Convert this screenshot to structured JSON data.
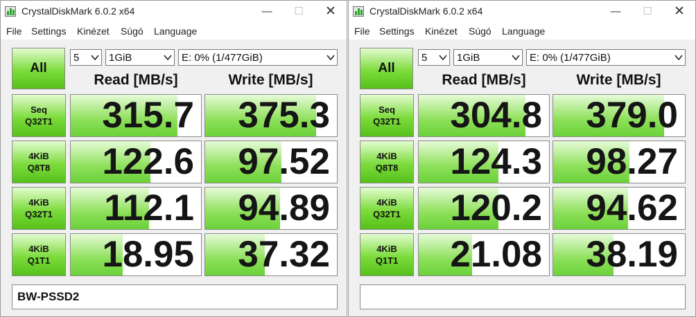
{
  "windows": [
    {
      "title": "CrystalDiskMark 6.0.2 x64",
      "menu": [
        "File",
        "Settings",
        "Kinézet",
        "Súgó",
        "Language"
      ],
      "all_label": "All",
      "test_count": "5",
      "test_size": "1GiB",
      "drive": "E: 0% (1/477GiB)",
      "read_header": "Read [MB/s]",
      "write_header": "Write [MB/s]",
      "rows": [
        {
          "label1": "Seq",
          "label2": "Q32T1",
          "read": "315.7",
          "write": "375.3",
          "read_bar": 0.82,
          "write_bar": 0.84
        },
        {
          "label1": "4KiB",
          "label2": "Q8T8",
          "read": "122.6",
          "write": "97.52",
          "read_bar": 0.61,
          "write_bar": 0.58
        },
        {
          "label1": "4KiB",
          "label2": "Q32T1",
          "read": "112.1",
          "write": "94.89",
          "read_bar": 0.6,
          "write_bar": 0.57
        },
        {
          "label1": "4KiB",
          "label2": "Q1T1",
          "read": "18.95",
          "write": "37.32",
          "read_bar": 0.4,
          "write_bar": 0.45
        }
      ],
      "comment": "BW-PSSD2"
    },
    {
      "title": "CrystalDiskMark 6.0.2 x64",
      "menu": [
        "File",
        "Settings",
        "Kinézet",
        "Súgó",
        "Language"
      ],
      "all_label": "All",
      "test_count": "5",
      "test_size": "1GiB",
      "drive": "E: 0% (1/477GiB)",
      "read_header": "Read [MB/s]",
      "write_header": "Write [MB/s]",
      "rows": [
        {
          "label1": "Seq",
          "label2": "Q32T1",
          "read": "304.8",
          "write": "379.0",
          "read_bar": 0.82,
          "write_bar": 0.84
        },
        {
          "label1": "4KiB",
          "label2": "Q8T8",
          "read": "124.3",
          "write": "98.27",
          "read_bar": 0.61,
          "write_bar": 0.58
        },
        {
          "label1": "4KiB",
          "label2": "Q32T1",
          "read": "120.2",
          "write": "94.62",
          "read_bar": 0.61,
          "write_bar": 0.57
        },
        {
          "label1": "4KiB",
          "label2": "Q1T1",
          "read": "21.08",
          "write": "38.19",
          "read_bar": 0.41,
          "write_bar": 0.46
        }
      ],
      "comment": ""
    }
  ]
}
